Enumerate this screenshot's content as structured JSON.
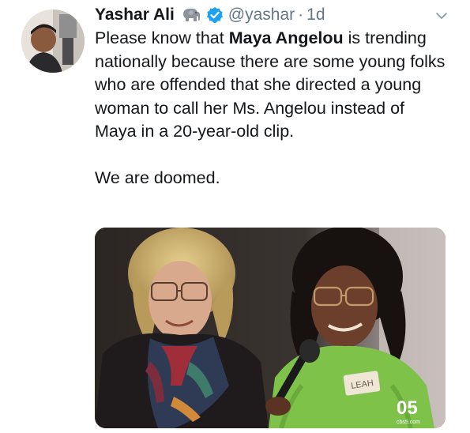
{
  "tweet": {
    "author": {
      "display_name": "Yashar Ali",
      "emoji_icon": "elephant-emoji",
      "verified_icon": "verified-badge-icon",
      "handle": "@yashar",
      "separator": "·",
      "time": "1d"
    },
    "menu_icon": "chevron-down-icon",
    "body": {
      "part1": "Please know that ",
      "bold_name": "Maya Angelou",
      "part2": " is trending nationally because there are some young folks who are offended that she directed a young woman to call her Ms. Angelou instead of Maya in a 20-year-old clip.",
      "closing": "We are doomed."
    },
    "media": {
      "name_tag": "LEAH",
      "channel_logo": "05",
      "channel_sub": "cbs5.com"
    }
  },
  "colors": {
    "text_primary": "#14171a",
    "text_secondary": "#657786",
    "verified_blue": "#1da1f2",
    "sweater_green": "#7fc24a"
  }
}
